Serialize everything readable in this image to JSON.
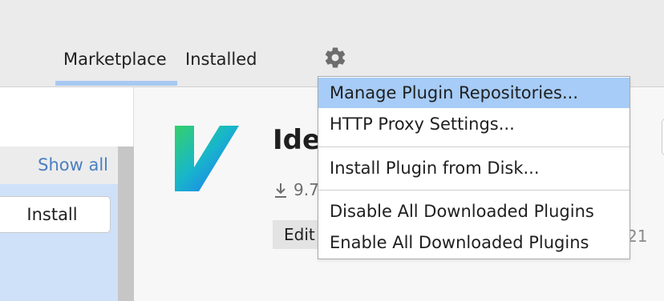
{
  "tabs": [
    {
      "label": "Marketplace",
      "active": true
    },
    {
      "label": "Installed",
      "active": false
    }
  ],
  "settings_icon": "gear-icon",
  "left_panel": {
    "show_all_label": "Show all",
    "install_label": "Install"
  },
  "plugin_detail": {
    "title_fragment": "Idea",
    "download_icon": "download-icon",
    "download_fragment": "9.7",
    "tag_fragment": "Edit",
    "date_fragment": "21"
  },
  "settings_menu": {
    "items": [
      {
        "label": "Manage Plugin Repositories...",
        "highlighted": true
      },
      {
        "label": "HTTP Proxy Settings..."
      },
      {
        "label": "Install Plugin from Disk..."
      },
      {
        "label": "Disable All Downloaded Plugins"
      },
      {
        "label": "Enable All Downloaded Plugins"
      }
    ]
  },
  "colors": {
    "tab_underline": "#a7c9f2",
    "menu_highlight": "#a6ccf7",
    "link": "#4a7fc1",
    "selection": "#cfe1f8"
  }
}
